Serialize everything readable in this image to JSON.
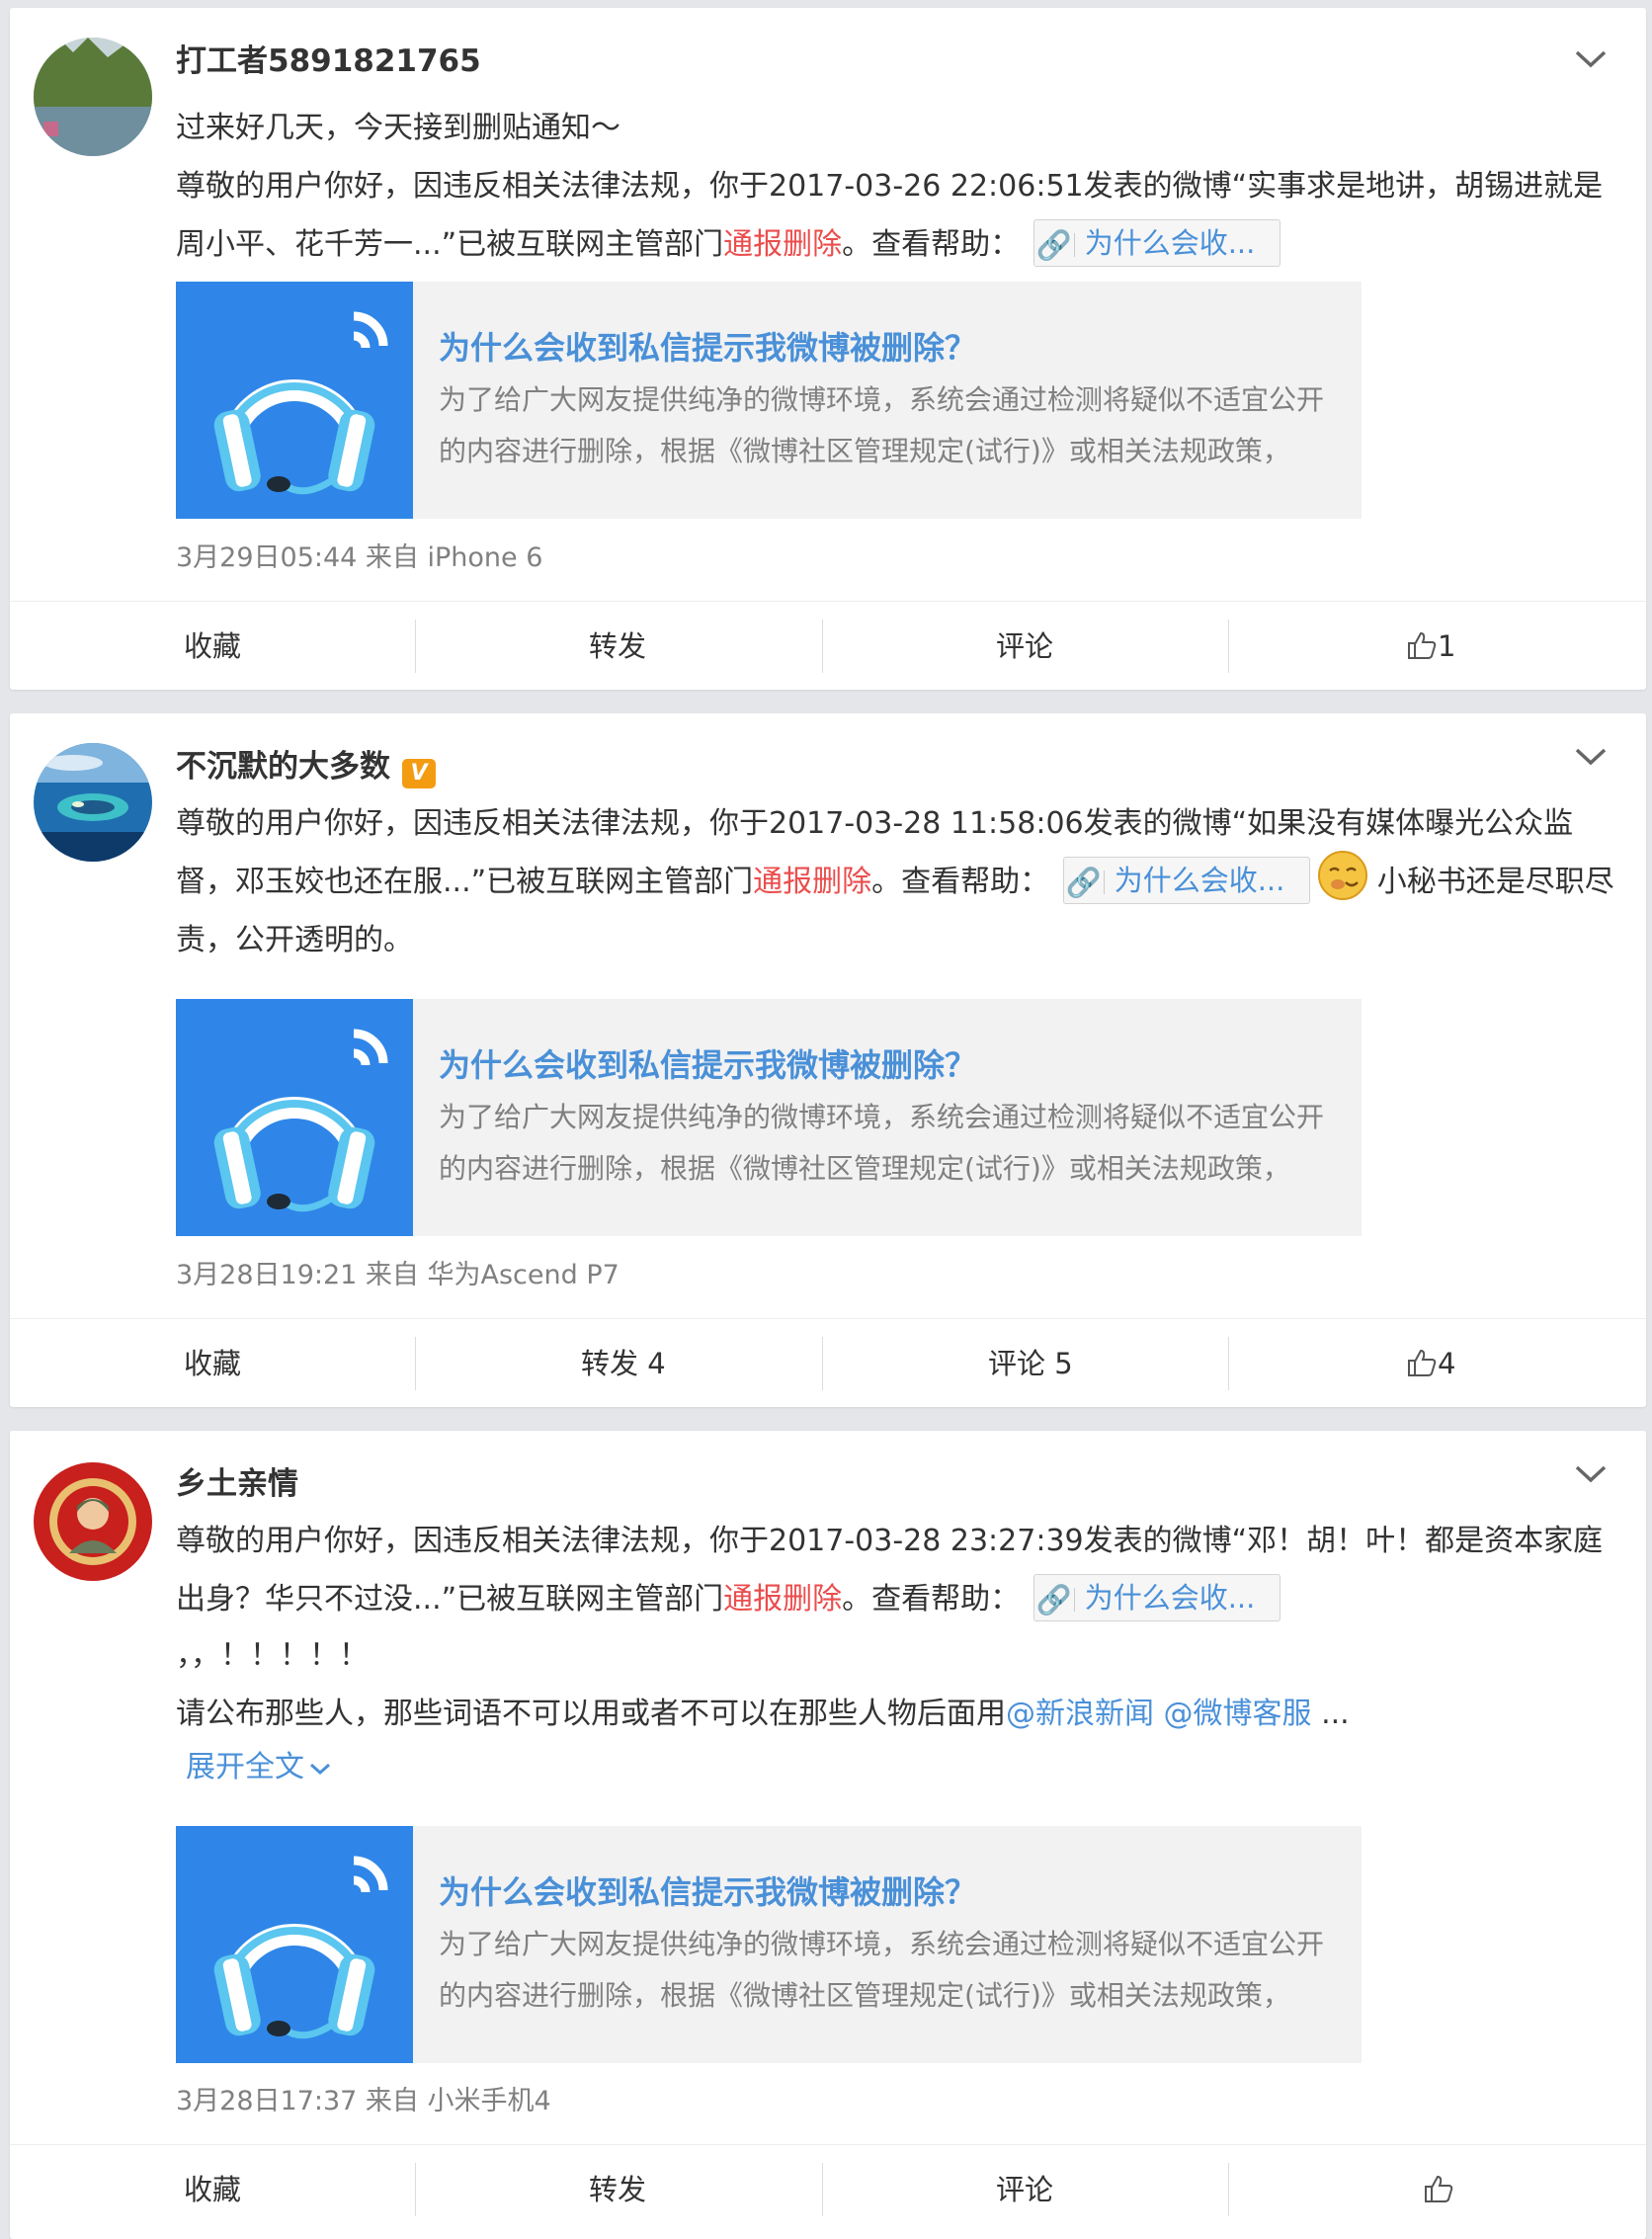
{
  "posts": [
    {
      "username": "打工者5891821765",
      "verified": false,
      "intro": "过来好几天，今天接到删贴通知～",
      "notice_prefix": "尊敬的用户你好，因违反相关法律法规，你于2017-03-26 22:06:51发表的微博“实事求是地讲，胡锡进就是周小平、花千芳一...”已被互联网主管部门",
      "notice_red": "通报删除",
      "notice_suffix": "。查看帮助：",
      "help_link": "为什么会收...",
      "after_text": "",
      "extra_line": "",
      "extra_mentions_text": "",
      "mention1": "",
      "mention2": "",
      "ellipsis": "",
      "expand_label": "",
      "preview": {
        "title": "为什么会收到私信提示我微博被删除？",
        "desc": "为了给广大网友提供纯净的微博环境，系统会通过检测将疑似不适宜公开的内容进行删除，根据《微博社区管理规定(试行)》或相关法规政策，"
      },
      "meta": "3月29日05:44 来自 iPhone 6",
      "actions": {
        "favorite": "收藏",
        "repost": "转发",
        "comment": "评论",
        "likes": "1"
      }
    },
    {
      "username": "不沉默的大多数",
      "verified": true,
      "badge": "V",
      "intro": "",
      "notice_prefix": "尊敬的用户你好，因违反相关法律法规，你于2017-03-28 11:58:06发表的微博“如果没有媒体曝光公众监督，邓玉姣也还在服...”已被互联网主管部门",
      "notice_red": "通报删除",
      "notice_suffix": "。查看帮助：",
      "help_link": "为什么会收...",
      "after_text": "小秘书还是尽职尽责，公开透明的。",
      "preview": {
        "title": "为什么会收到私信提示我微博被删除？",
        "desc": "为了给广大网友提供纯净的微博环境，系统会通过检测将疑似不适宜公开的内容进行删除，根据《微博社区管理规定(试行)》或相关法规政策，"
      },
      "meta": "3月28日19:21 来自 华为Ascend P7",
      "actions": {
        "favorite": "收藏",
        "repost": "转发 4",
        "comment": "评论 5",
        "likes": "4"
      }
    },
    {
      "username": "乡土亲情",
      "verified": false,
      "intro": "",
      "notice_prefix": "尊敬的用户你好，因违反相关法律法规，你于2017-03-28 23:27:39发表的微博“邓！胡！叶！都是资本家庭出身？华只不过没...”已被互联网主管部门",
      "notice_red": "通报删除",
      "notice_suffix": "。查看帮助：",
      "help_link": "为什么会收...",
      "extra_line": "，，！！！！！",
      "extra_mentions_text": "请公布那些人，那些词语不可以用或者不可以在那些人物后面用",
      "mention1": "@新浪新闻",
      "mention2": "@微博客服",
      "ellipsis": "...",
      "expand_label": "展开全文",
      "preview": {
        "title": "为什么会收到私信提示我微博被删除？",
        "desc": "为了给广大网友提供纯净的微博环境，系统会通过检测将疑似不适宜公开的内容进行删除，根据《微博社区管理规定(试行)》或相关法规政策，"
      },
      "meta": "3月28日17:37 来自 小米手机4",
      "actions": {
        "favorite": "收藏",
        "repost": "转发",
        "comment": "评论",
        "likes": ""
      }
    }
  ],
  "colors": {
    "background": "#e4e6ea",
    "link_blue": "#4a90d8",
    "alert_red": "#eb4d4d",
    "thumb_blue": "#2f86e8",
    "verified_badge": "#f39c12"
  },
  "icons": [
    "chevron-down-icon",
    "link-icon",
    "headphones-icon",
    "thumbs-up-icon",
    "smirk-emoji-icon"
  ]
}
